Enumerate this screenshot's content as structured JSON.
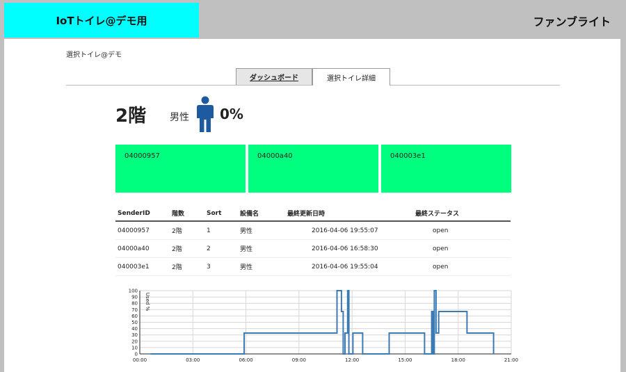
{
  "header": {
    "title": "IoTトイレ@デモ用",
    "company": "ファンブライト"
  },
  "breadcrumb": "選択トイレ@デモ",
  "tabs": [
    {
      "label": "ダッシュボード"
    },
    {
      "label": "選択トイレ詳細",
      "active": true
    }
  ],
  "summary": {
    "floor": "2階",
    "gender": "男性",
    "usage": "0%"
  },
  "colors": {
    "brand": "#00ffff",
    "tile": "#00ff7f",
    "icon": "#1e5aa0",
    "line": "#3a7ab5"
  },
  "tiles": [
    "04000957",
    "04000a40",
    "040003e1"
  ],
  "table": {
    "headers": [
      "SenderID",
      "階数",
      "Sort",
      "設備名",
      "最終更新日時",
      "最終ステータス"
    ],
    "rows": [
      [
        "04000957",
        "2階",
        "1",
        "男性",
        "2016-04-06 19:55:07",
        "open"
      ],
      [
        "04000a40",
        "2階",
        "2",
        "男性",
        "2016-04-06 16:58:30",
        "open"
      ],
      [
        "040003e1",
        "2階",
        "3",
        "男性",
        "2016-04-06 19:55:04",
        "open"
      ]
    ]
  },
  "chart_data": {
    "type": "line",
    "ylabel": "Used %",
    "ylim": [
      0,
      100
    ],
    "yticks": [
      0,
      10,
      20,
      30,
      40,
      50,
      60,
      70,
      80,
      90,
      100
    ],
    "xlim": [
      0,
      21
    ],
    "xticks": [
      {
        "v": 0,
        "label": "00:00"
      },
      {
        "v": 3,
        "label": "03:00"
      },
      {
        "v": 6,
        "label": "06:00"
      },
      {
        "v": 9,
        "label": "09:00"
      },
      {
        "v": 12,
        "label": "12:00"
      },
      {
        "v": 15,
        "label": "15:00"
      },
      {
        "v": 18,
        "label": "18:00"
      },
      {
        "v": 21,
        "label": "21:00"
      }
    ],
    "grid": true,
    "points": [
      [
        0.6,
        0
      ],
      [
        5.9,
        0
      ],
      [
        5.9,
        33
      ],
      [
        11.15,
        33
      ],
      [
        11.15,
        100
      ],
      [
        11.4,
        100
      ],
      [
        11.4,
        67
      ],
      [
        11.5,
        67
      ],
      [
        11.5,
        0
      ],
      [
        11.6,
        0
      ],
      [
        11.6,
        33
      ],
      [
        11.75,
        33
      ],
      [
        11.75,
        100
      ],
      [
        11.82,
        100
      ],
      [
        11.82,
        0
      ],
      [
        12.05,
        0
      ],
      [
        12.05,
        33
      ],
      [
        12.6,
        33
      ],
      [
        12.6,
        0
      ],
      [
        14.1,
        0
      ],
      [
        14.1,
        33
      ],
      [
        16.1,
        33
      ],
      [
        16.1,
        0
      ],
      [
        16.5,
        0
      ],
      [
        16.5,
        67
      ],
      [
        16.58,
        67
      ],
      [
        16.58,
        0
      ],
      [
        16.65,
        0
      ],
      [
        16.65,
        100
      ],
      [
        16.75,
        100
      ],
      [
        16.75,
        33
      ],
      [
        16.9,
        33
      ],
      [
        16.9,
        67
      ],
      [
        18.5,
        67
      ],
      [
        18.5,
        33
      ],
      [
        20.0,
        33
      ],
      [
        20.0,
        0
      ]
    ]
  }
}
